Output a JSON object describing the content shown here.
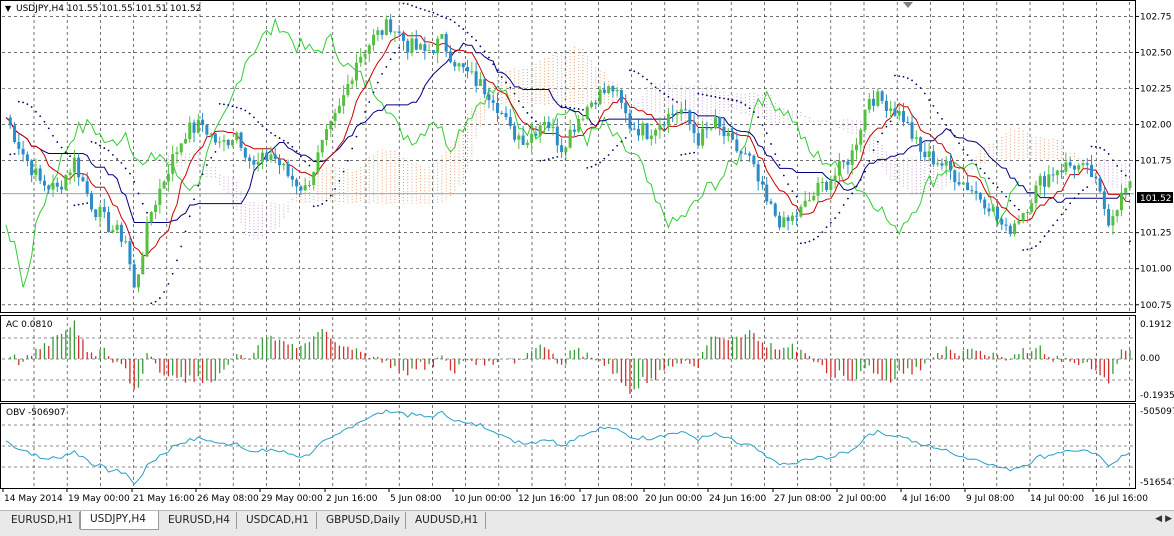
{
  "colors": {
    "bull_candle": "#55c040",
    "bear_candle": "#2a8dc8",
    "tenkan": "#cc0000",
    "kijun": "#000080",
    "chikou": "#33cc33",
    "cloud_up": "#e8a070",
    "cloud_down": "#c9a0d8",
    "parabolic_sar": "#000066",
    "ac_up": "#3a9a3a",
    "ac_down": "#d03030",
    "obv": "#2a9fc6",
    "grid": "#1a1a1a"
  },
  "main_panel": {
    "title": "USDJPY,H4  101.55 101.55 101.51 101.52",
    "price_labels": [
      "102.75",
      "102.50",
      "102.25",
      "102.00",
      "101.75",
      "101.52",
      "101.25",
      "101.00",
      "100.75"
    ],
    "current_price": "101.52"
  },
  "ac_panel": {
    "label": "AC 0.0810",
    "scale_labels": [
      "0.1912",
      "0.00",
      "-0.1935"
    ]
  },
  "obv_panel": {
    "label": "OBV -506907",
    "scale_labels": [
      "-505097",
      "-516547"
    ]
  },
  "time_axis": [
    "14 May 2014",
    "19 May 00:00",
    "21 May 16:00",
    "26 May 08:00",
    "29 May 00:00",
    "2 Jun 16:00",
    "5 Jun 08:00",
    "10 Jun 00:00",
    "12 Jun 16:00",
    "17 Jun 08:00",
    "20 Jun 00:00",
    "24 Jun 16:00",
    "27 Jun 08:00",
    "2 Jul 00:00",
    "4 Jul 16:00",
    "9 Jul 08:00",
    "14 Jul 00:00",
    "16 Jul 16:00"
  ],
  "tabs": [
    {
      "label": "EURUSD,H1"
    },
    {
      "label": "USDJPY,H4"
    },
    {
      "label": "EURUSD,H4"
    },
    {
      "label": "USDCAD,H1"
    },
    {
      "label": "GBPUSD,Daily"
    },
    {
      "label": "AUDUSD,H1"
    }
  ],
  "active_tab": "USDJPY,H4",
  "tab_scroll_icons": [
    "scroll-left-icon",
    "scroll-right-icon"
  ],
  "chart_data": {
    "type": "candlestick",
    "symbol": "USDJPY",
    "timeframe": "H4",
    "ylim": [
      100.7,
      102.85
    ],
    "close_path": [
      [
        0,
        102.05
      ],
      [
        4,
        101.8
      ],
      [
        8,
        101.6
      ],
      [
        12,
        101.55
      ],
      [
        16,
        101.75
      ],
      [
        20,
        101.45
      ],
      [
        24,
        101.3
      ],
      [
        28,
        101.2
      ],
      [
        30,
        100.85
      ],
      [
        34,
        101.4
      ],
      [
        38,
        101.7
      ],
      [
        42,
        101.95
      ],
      [
        46,
        102.0
      ],
      [
        50,
        101.85
      ],
      [
        54,
        101.95
      ],
      [
        58,
        101.7
      ],
      [
        62,
        101.8
      ],
      [
        66,
        101.65
      ],
      [
        70,
        101.55
      ],
      [
        74,
        101.85
      ],
      [
        78,
        102.1
      ],
      [
        82,
        102.45
      ],
      [
        86,
        102.6
      ],
      [
        90,
        102.7
      ],
      [
        94,
        102.55
      ],
      [
        98,
        102.5
      ],
      [
        102,
        102.58
      ],
      [
        106,
        102.4
      ],
      [
        110,
        102.3
      ],
      [
        114,
        102.2
      ],
      [
        118,
        101.95
      ],
      [
        122,
        101.9
      ],
      [
        126,
        102.05
      ],
      [
        130,
        101.85
      ],
      [
        134,
        102.05
      ],
      [
        138,
        102.2
      ],
      [
        142,
        102.25
      ],
      [
        146,
        102.0
      ],
      [
        150,
        101.95
      ],
      [
        154,
        102.05
      ],
      [
        158,
        102.1
      ],
      [
        162,
        101.9
      ],
      [
        166,
        102.0
      ],
      [
        170,
        101.85
      ],
      [
        174,
        101.75
      ],
      [
        178,
        101.45
      ],
      [
        182,
        101.3
      ],
      [
        186,
        101.4
      ],
      [
        190,
        101.55
      ],
      [
        194,
        101.65
      ],
      [
        198,
        101.8
      ],
      [
        202,
        102.2
      ],
      [
        206,
        102.15
      ],
      [
        210,
        102.05
      ],
      [
        214,
        101.8
      ],
      [
        218,
        101.75
      ],
      [
        222,
        101.65
      ],
      [
        226,
        101.55
      ],
      [
        230,
        101.45
      ],
      [
        234,
        101.25
      ],
      [
        238,
        101.4
      ],
      [
        242,
        101.6
      ],
      [
        246,
        101.7
      ],
      [
        250,
        101.72
      ],
      [
        254,
        101.65
      ],
      [
        258,
        101.35
      ],
      [
        262,
        101.55
      ]
    ],
    "time_labels": [
      "14 May 2014",
      "19 May 00:00",
      "21 May 16:00",
      "26 May 08:00",
      "29 May 00:00",
      "2 Jun 16:00",
      "5 Jun 08:00",
      "10 Jun 00:00",
      "12 Jun 16:00",
      "17 Jun 08:00",
      "20 Jun 00:00",
      "24 Jun 16:00",
      "27 Jun 08:00",
      "2 Jul 00:00",
      "4 Jul 16:00",
      "9 Jul 08:00",
      "14 Jul 00:00",
      "16 Jul 16:00"
    ],
    "last_price": 101.52,
    "indicators": [
      "Ichimoku",
      "Parabolic SAR",
      "AC",
      "OBV"
    ],
    "ac_range": [
      -0.1935,
      0.1912
    ],
    "obv_range": [
      -516547,
      -505097
    ]
  }
}
